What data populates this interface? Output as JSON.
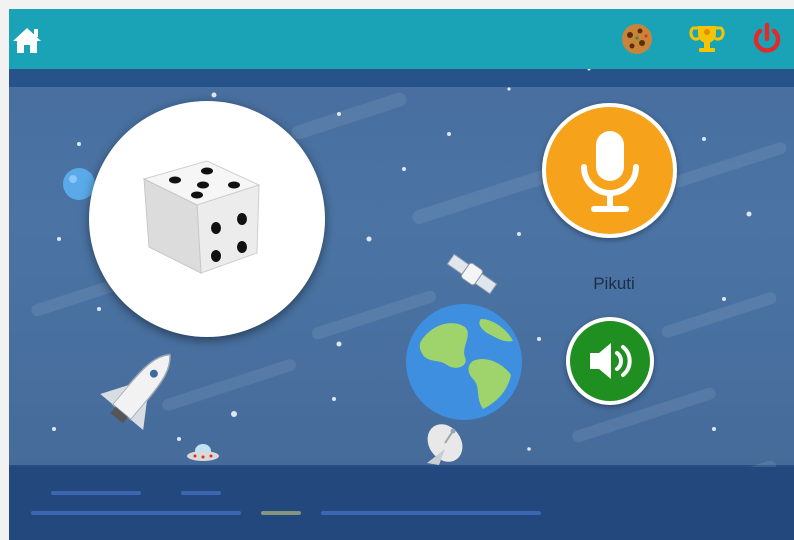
{
  "topbar": {
    "home_icon": "home-icon",
    "cookie_icon": "cookie-icon",
    "trophy_icon": "trophy-icon",
    "power_icon": "power-icon",
    "colors": {
      "bar": "#1aa3b7",
      "power": "#e02b2b",
      "trophy": "#f5c400"
    }
  },
  "card": {
    "image": "dice",
    "dice_top_face_pips": 5,
    "dice_front_face_pips": 4
  },
  "controls": {
    "mic_icon": "microphone-icon",
    "word_label": "Pikuti",
    "speaker_icon": "speaker-icon",
    "colors": {
      "mic": "#f7a21b",
      "speaker": "#1f8f22"
    }
  },
  "scene": {
    "background_color": "#2b5b93",
    "decorations": [
      "planet",
      "space-shuttle",
      "satellite",
      "earth",
      "ufo",
      "satellite-dish"
    ]
  }
}
